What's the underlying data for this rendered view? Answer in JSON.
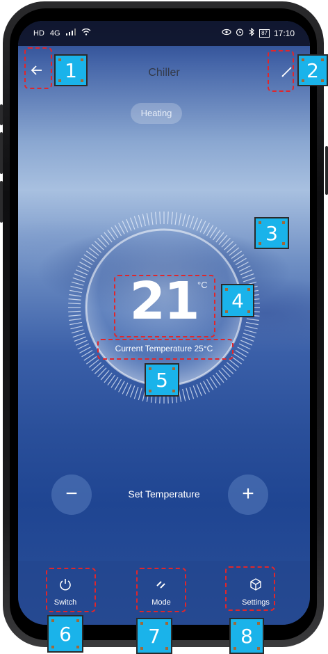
{
  "status_bar": {
    "left_icons": [
      "HD",
      "4G",
      "signal",
      "wifi"
    ],
    "right_icons": [
      "eye",
      "alarm",
      "bluetooth"
    ],
    "battery": "87",
    "time": "17:10"
  },
  "header": {
    "title": "Chiller",
    "back_icon": "back-arrow-icon",
    "edit_icon": "pencil-icon"
  },
  "mode_badge": "Heating",
  "thermostat": {
    "set_value": "21",
    "unit": "°C",
    "current_label": "Current Temperature 25°C",
    "dial_level_fraction": 0.5
  },
  "controls": {
    "decrease_symbol": "−",
    "label": "Set Temperature",
    "increase_symbol": "+"
  },
  "nav": [
    {
      "label": "Switch",
      "icon": "power-icon"
    },
    {
      "label": "Mode",
      "icon": "mode-icon"
    },
    {
      "label": "Settings",
      "icon": "settings-cube-icon"
    }
  ],
  "callouts": [
    "1",
    "2",
    "3",
    "4",
    "5",
    "6",
    "7",
    "8"
  ],
  "colors": {
    "callout_fill": "#1ab3ea",
    "annotation_dash": "#e0262b"
  }
}
